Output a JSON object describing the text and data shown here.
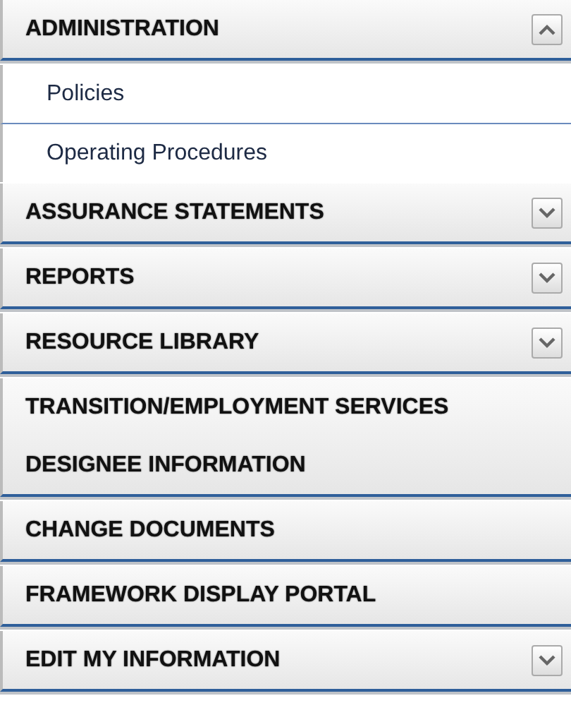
{
  "menu": [
    {
      "kind": "group",
      "title": "ADMINISTRATION",
      "expanded": true,
      "children": [
        {
          "label": "Policies"
        },
        {
          "label": "Operating Procedures"
        }
      ]
    },
    {
      "kind": "group",
      "title": "ASSURANCE STATEMENTS",
      "expanded": false
    },
    {
      "kind": "group",
      "title": "REPORTS",
      "expanded": false
    },
    {
      "kind": "group",
      "title": "RESOURCE LIBRARY",
      "expanded": false
    },
    {
      "kind": "link",
      "title": "TRANSITION/EMPLOYMENT SERVICES DESIGNEE INFORMATION"
    },
    {
      "kind": "link",
      "title": "CHANGE DOCUMENTS"
    },
    {
      "kind": "link",
      "title": "FRAMEWORK DISPLAY PORTAL"
    },
    {
      "kind": "group",
      "title": "EDIT MY INFORMATION",
      "expanded": false
    }
  ]
}
